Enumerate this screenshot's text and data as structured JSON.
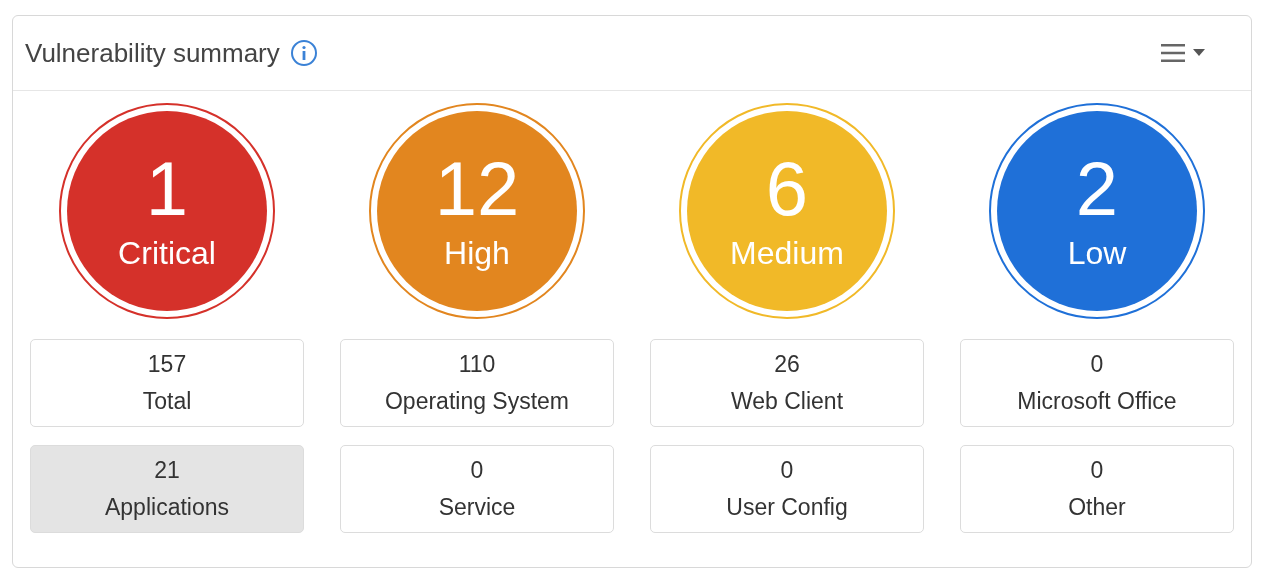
{
  "panel": {
    "title": "Vulnerability summary"
  },
  "severities": [
    {
      "count": "1",
      "label": "Critical",
      "color": "#d5312a"
    },
    {
      "count": "12",
      "label": "High",
      "color": "#e2861f"
    },
    {
      "count": "6",
      "label": "Medium",
      "color": "#f1b928"
    },
    {
      "count": "2",
      "label": "Low",
      "color": "#1f70d8"
    }
  ],
  "stats": [
    {
      "value": "157",
      "label": "Total",
      "selected": false
    },
    {
      "value": "110",
      "label": "Operating System",
      "selected": false
    },
    {
      "value": "26",
      "label": "Web Client",
      "selected": false
    },
    {
      "value": "0",
      "label": "Microsoft Office",
      "selected": false
    },
    {
      "value": "21",
      "label": "Applications",
      "selected": true
    },
    {
      "value": "0",
      "label": "Service",
      "selected": false
    },
    {
      "value": "0",
      "label": "User Config",
      "selected": false
    },
    {
      "value": "0",
      "label": "Other",
      "selected": false
    }
  ]
}
